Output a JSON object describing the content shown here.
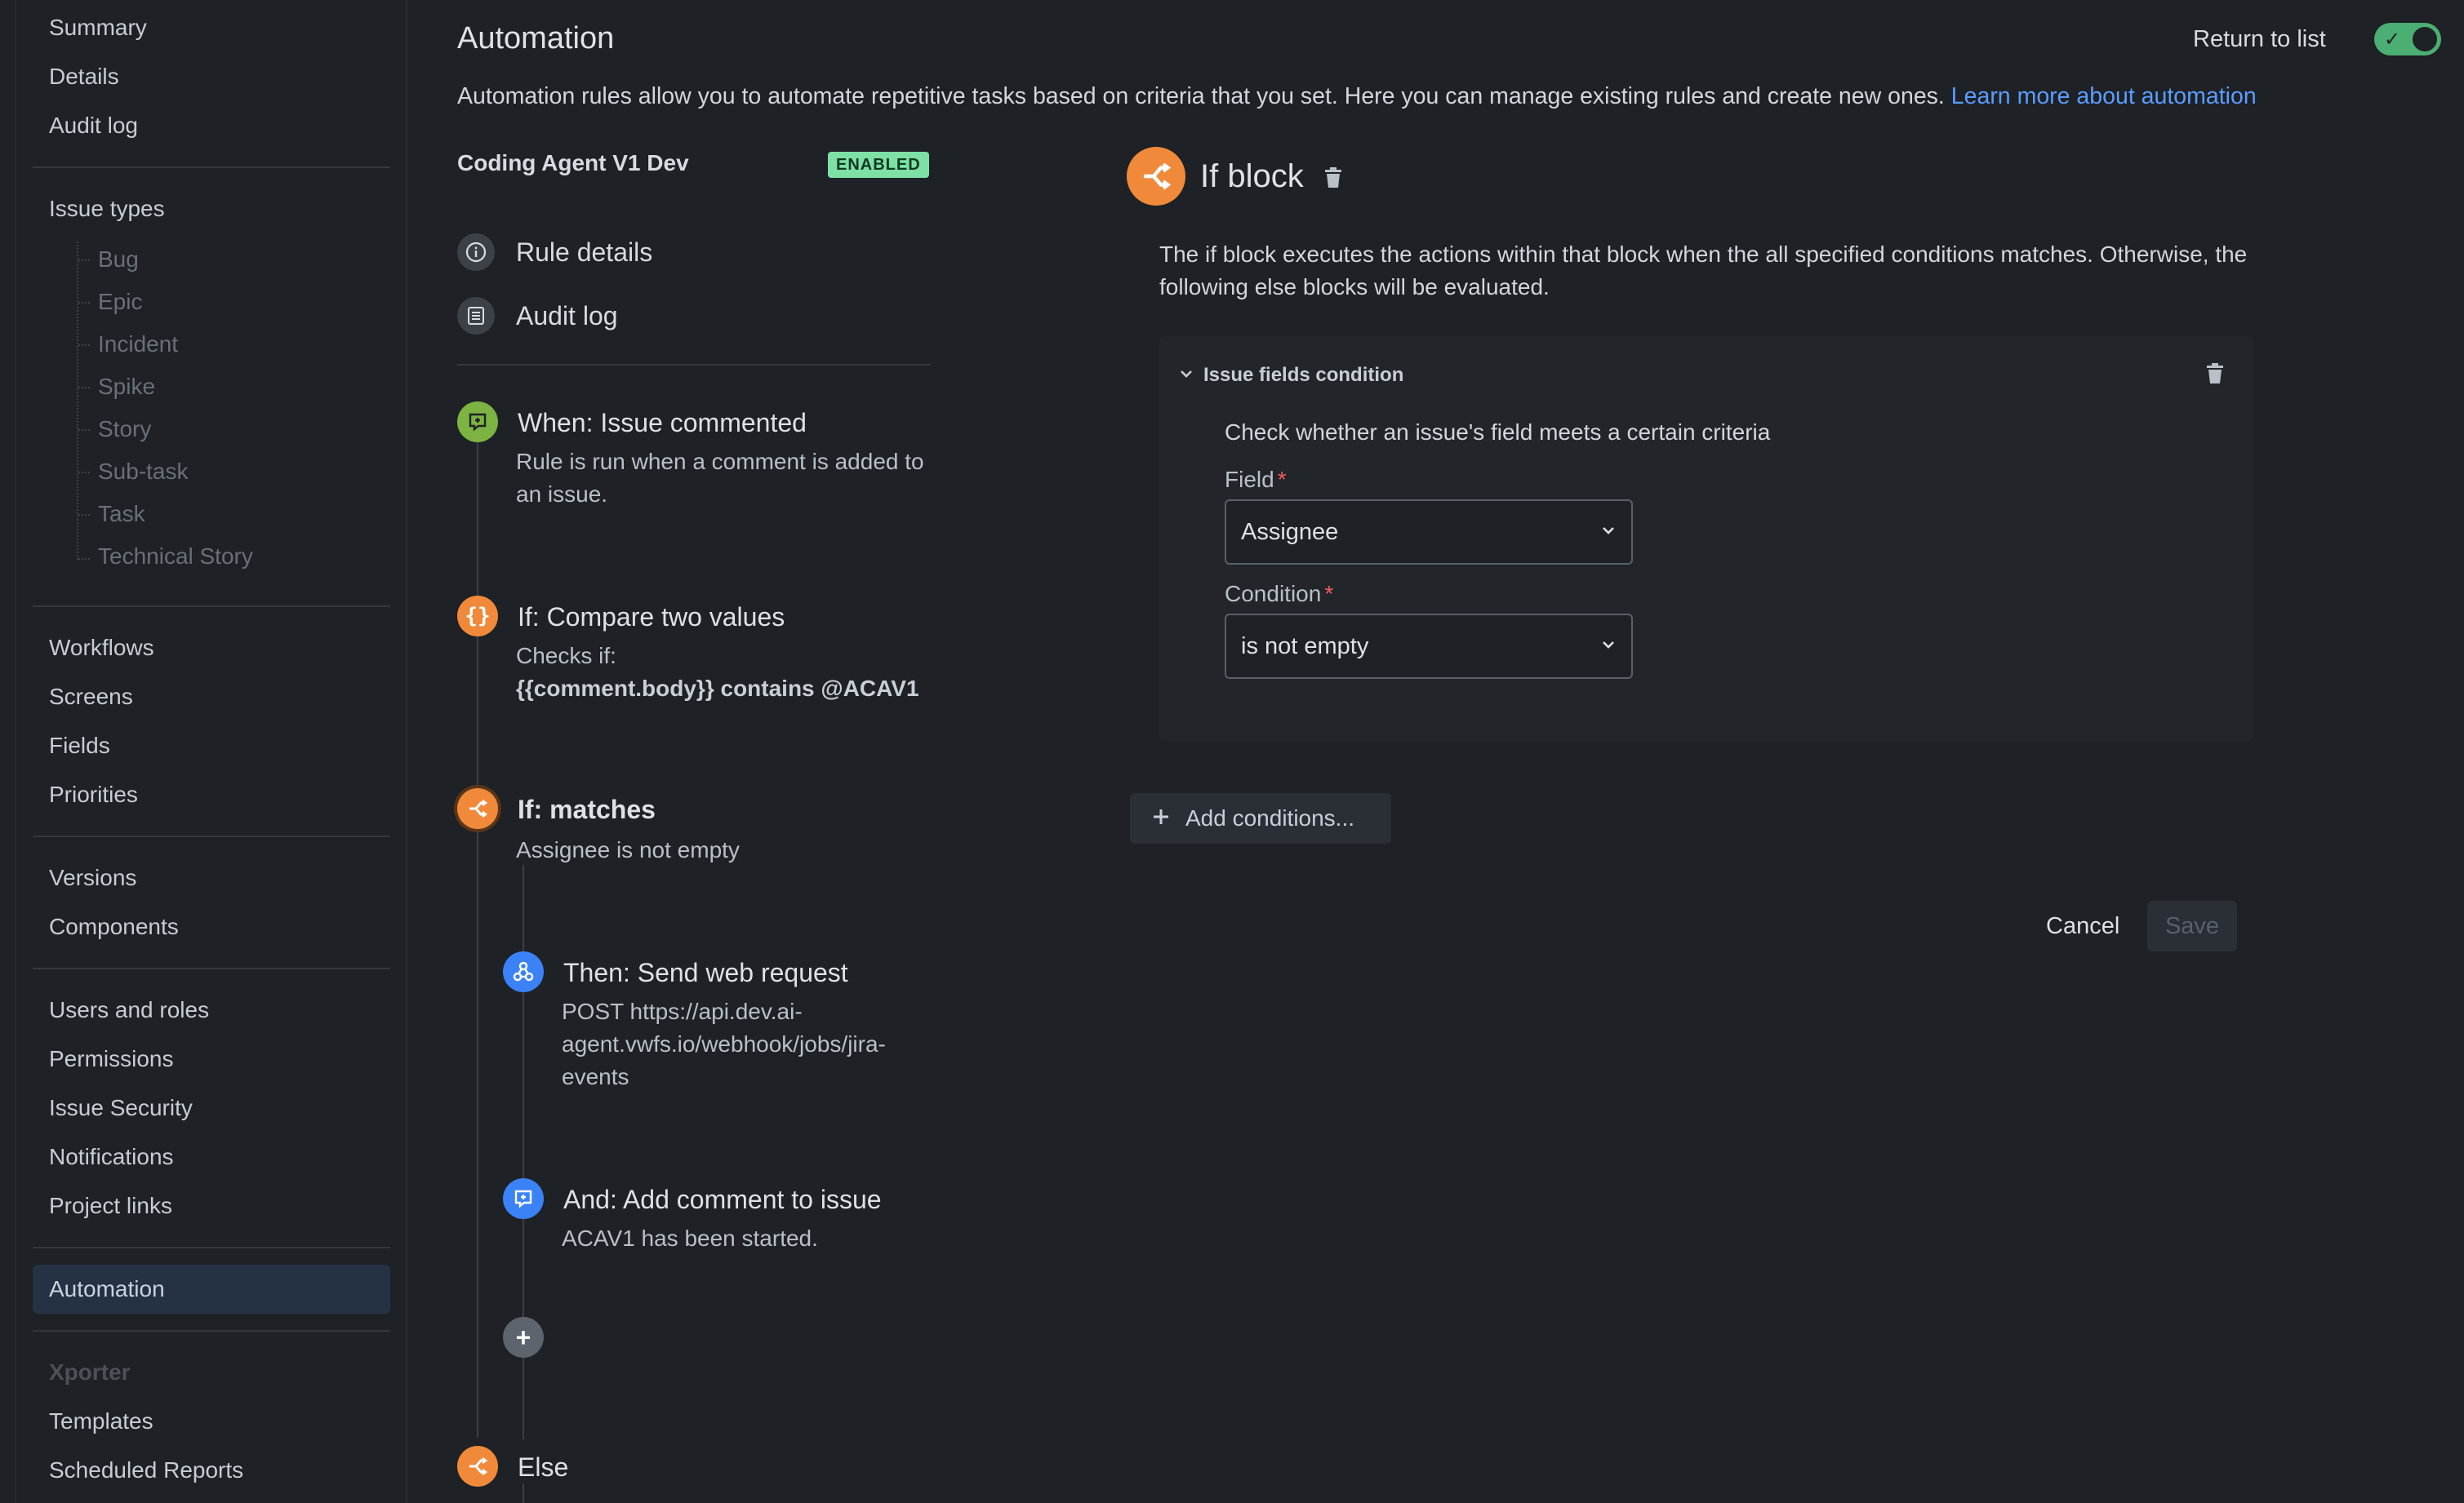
{
  "sidebar": {
    "top_items": [
      "Summary",
      "Details",
      "Audit log"
    ],
    "issue_types_heading": "Issue types",
    "issue_types": [
      "Bug",
      "Epic",
      "Incident",
      "Spike",
      "Story",
      "Sub-task",
      "Task",
      "Technical Story"
    ],
    "group2": [
      "Workflows",
      "Screens",
      "Fields",
      "Priorities"
    ],
    "group3": [
      "Versions",
      "Components"
    ],
    "group4": [
      "Users and roles",
      "Permissions",
      "Issue Security",
      "Notifications",
      "Project links"
    ],
    "active_item": "Automation",
    "xporter_heading": "Xporter",
    "xporter_items": [
      "Templates",
      "Scheduled Reports"
    ]
  },
  "header": {
    "title": "Automation",
    "return_link": "Return to list",
    "toggle_state": "on",
    "intro_text": "Automation rules allow you to automate repetitive tasks based on criteria that you set. Here you can manage existing rules and create new ones.",
    "learn_more": "Learn more about automation"
  },
  "rule": {
    "name": "Coding Agent V1 Dev",
    "status_badge": "ENABLED",
    "menu": [
      "Rule details",
      "Audit log"
    ],
    "steps": {
      "trigger": {
        "title": "When: Issue commented",
        "desc": "Rule is run when a comment is added to an issue."
      },
      "compare": {
        "title": "If: Compare two values",
        "desc_line1": "Checks if:",
        "desc_line2": "{{comment.body}} contains @ACAV1"
      },
      "matches": {
        "title": "If: matches",
        "desc": "Assignee is not empty"
      },
      "webhook": {
        "title": "Then: Send web request",
        "desc": "POST https://api.dev.ai-agent.vwfs.io/webhook/jobs/jira-events"
      },
      "comment": {
        "title": "And: Add comment to issue",
        "desc": "ACAV1 has been started."
      },
      "else": {
        "title": "Else"
      }
    }
  },
  "detail": {
    "title": "If block",
    "description": "The if block executes the actions within that block when the all specified conditions matches. Otherwise, the following else blocks will be evaluated.",
    "condition": {
      "header": "Issue fields condition",
      "subtitle": "Check whether an issue's field meets a certain criteria",
      "field_label": "Field",
      "field_value": "Assignee",
      "condition_label": "Condition",
      "condition_value": "is not empty",
      "required_mark": "*"
    },
    "add_conditions": "Add conditions...",
    "cancel": "Cancel",
    "save": "Save"
  },
  "colors": {
    "background": "#1e2125",
    "accent_link": "#5b9dff",
    "enabled_badge": "#7ee0a5",
    "toggle_on": "#4bae72",
    "trigger_green": "#7cb342",
    "condition_orange": "#f08a3a",
    "action_blue": "#3b82f6"
  }
}
